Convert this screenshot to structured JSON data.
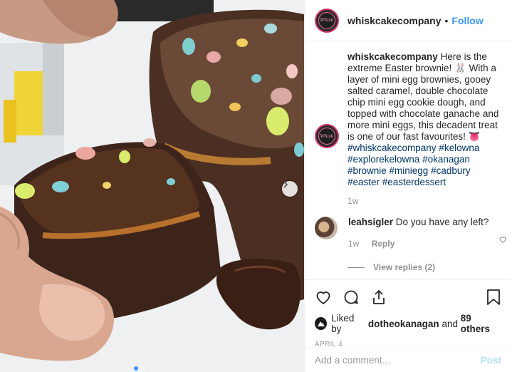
{
  "post": {
    "username": "whiskcakecompany",
    "separator": "•",
    "follow_label": "Follow",
    "avatar_text": "Whisk"
  },
  "caption": {
    "username": "whiskcakecompany",
    "text": "Here is the extreme Easter brownie! 🐰 With a layer of mini egg brownies, gooey salted caramel, double chocolate chip mini egg cookie dough, and topped with chocolate ganache and more mini eggs, this decadent treat is one of our fast favourites! 👅",
    "hashtags": "#whiskcakecompany #kelowna #explorekelowna #okanagan #brownie #miniegg #cadbury #easter #easterdessert",
    "time": "1w"
  },
  "reply": {
    "username": "leahsigler",
    "text": "Do you have any left?",
    "time": "1w",
    "reply_label": "Reply",
    "view_replies": "View replies (2)"
  },
  "actions": {
    "icons": [
      "heart-icon",
      "comment-icon",
      "share-icon",
      "bookmark-icon"
    ],
    "liked_by_prefix": "Liked by",
    "liked_by_user": "dotheokanagan",
    "liked_by_and": "and",
    "liked_by_others": "89 others",
    "date": "APRIL 4"
  },
  "comment_box": {
    "placeholder": "Add a comment…",
    "post_label": "Post"
  },
  "carousel": {
    "slide_count": 2,
    "active_index": 0
  },
  "colors": {
    "link": "#3897f0",
    "hashtag": "#003569",
    "muted": "#8e8e8e",
    "post_disabled": "#b2dffc",
    "avatar_ring": "#d6336c"
  }
}
